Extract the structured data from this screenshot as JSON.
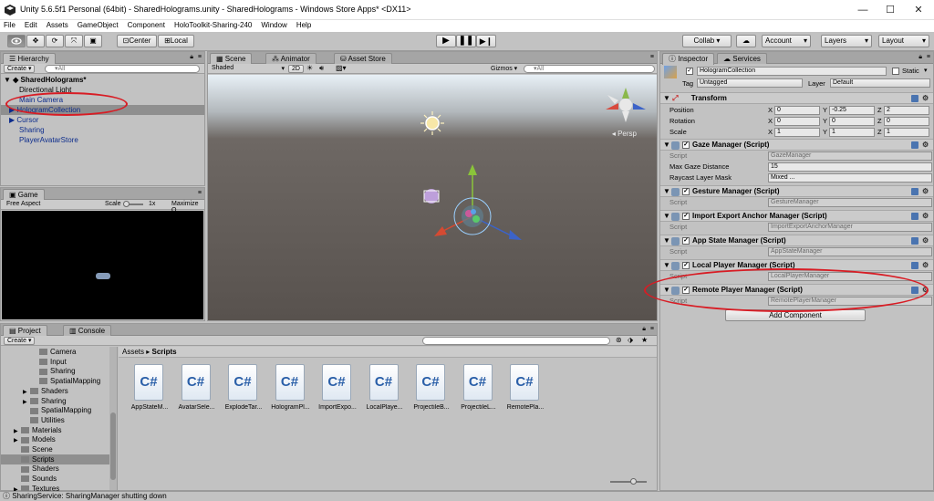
{
  "window": {
    "title": "Unity 5.6.5f1 Personal (64bit) - SharedHolograms.unity - SharedHolograms - Windows Store Apps* <DX11>",
    "minimize": "—",
    "maximize": "☐",
    "close": "✕"
  },
  "menu": [
    "File",
    "Edit",
    "Assets",
    "GameObject",
    "Component",
    "HoloToolkit-Sharing-240",
    "Window",
    "Help"
  ],
  "toolbar": {
    "center": "Center",
    "local": "Local",
    "collab": "Collab ▾",
    "account": "Account",
    "layers": "Layers",
    "layout": "Layout"
  },
  "hierarchy": {
    "tab": "Hierarchy",
    "create": "Create ▾",
    "search_placeholder": "▾All",
    "scene": "SharedHolograms*",
    "items": [
      "Directional Light",
      "Main Camera",
      "HologramCollection",
      "Cursor",
      "Sharing",
      "PlayerAvatarStore"
    ]
  },
  "scene_view": {
    "tabs": [
      "Scene",
      "Animator",
      "Asset Store"
    ],
    "shaded": "Shaded",
    "mode_2d": "2D",
    "gizmos": "Gizmos ▾",
    "search_placeholder": "▾All",
    "persp": "◂ Persp"
  },
  "game_view": {
    "tab": "Game",
    "aspect": "Free Aspect",
    "scale_label": "Scale",
    "scale_value": "1x",
    "maximize": "Maximize O"
  },
  "project": {
    "tabs": [
      "Project",
      "Console"
    ],
    "create": "Create ▾",
    "breadcrumb_root": "Assets",
    "breadcrumb_sep": "▸",
    "breadcrumb_current": "Scripts",
    "tree": [
      {
        "label": "Camera",
        "indent": 2,
        "arrow": ""
      },
      {
        "label": "Input",
        "indent": 2,
        "arrow": ""
      },
      {
        "label": "Sharing",
        "indent": 2,
        "arrow": ""
      },
      {
        "label": "SpatialMapping",
        "indent": 2,
        "arrow": ""
      },
      {
        "label": "Shaders",
        "indent": 1,
        "arrow": "▶"
      },
      {
        "label": "Sharing",
        "indent": 1,
        "arrow": "▶"
      },
      {
        "label": "SpatialMapping",
        "indent": 1,
        "arrow": ""
      },
      {
        "label": "Utilities",
        "indent": 1,
        "arrow": ""
      },
      {
        "label": "Materials",
        "indent": 0,
        "arrow": "▶"
      },
      {
        "label": "Models",
        "indent": 0,
        "arrow": "▶"
      },
      {
        "label": "Scene",
        "indent": 0,
        "arrow": ""
      },
      {
        "label": "Scripts",
        "indent": 0,
        "arrow": ""
      },
      {
        "label": "Shaders",
        "indent": 0,
        "arrow": ""
      },
      {
        "label": "Sounds",
        "indent": 0,
        "arrow": ""
      },
      {
        "label": "Textures",
        "indent": 0,
        "arrow": "▶"
      }
    ],
    "files": [
      "AppStateM...",
      "AvatarSele...",
      "ExplodeTar...",
      "HologramPl...",
      "ImportExpo...",
      "LocalPlaye...",
      "ProjectileB...",
      "ProjectileL...",
      "RemotePla..."
    ],
    "file_glyph": "C#"
  },
  "inspector": {
    "tabs": [
      "Inspector",
      "Services"
    ],
    "object_name": "HologramCollection",
    "static_label": "Static",
    "tag_label": "Tag",
    "tag_value": "Untagged",
    "layer_label": "Layer",
    "layer_value": "Default",
    "transform": {
      "title": "Transform",
      "rows": [
        {
          "label": "Position",
          "x": "0",
          "y": "-0.25",
          "z": "2"
        },
        {
          "label": "Rotation",
          "x": "0",
          "y": "0",
          "z": "0"
        },
        {
          "label": "Scale",
          "x": "1",
          "y": "1",
          "z": "1"
        }
      ]
    },
    "axis": {
      "x": "X",
      "y": "Y",
      "z": "Z"
    },
    "script_label": "Script",
    "components": [
      {
        "title": "Gaze Manager (Script)",
        "script": "GazeManager",
        "extra": [
          {
            "label": "Max Gaze Distance",
            "value": "15"
          },
          {
            "label": "Raycast Layer Mask",
            "value": "Mixed ..."
          }
        ]
      },
      {
        "title": "Gesture Manager (Script)",
        "script": "GestureManager",
        "extra": []
      },
      {
        "title": "Import Export Anchor Manager (Script)",
        "script": "ImportExportAnchorManager",
        "extra": []
      },
      {
        "title": "App State Manager (Script)",
        "script": "AppStateManager",
        "extra": []
      },
      {
        "title": "Local Player Manager (Script)",
        "script": "LocalPlayerManager",
        "extra": []
      },
      {
        "title": "Remote Player Manager (Script)",
        "script": "RemotePlayerManager",
        "extra": []
      }
    ],
    "add_component": "Add Component"
  },
  "status": {
    "message": "SharingService: SharingManager shutting down"
  },
  "colors": {
    "annotation_red": "#d81c24",
    "selection": "#8f8f8f",
    "hierarchy_text": "#0c2c8c"
  }
}
